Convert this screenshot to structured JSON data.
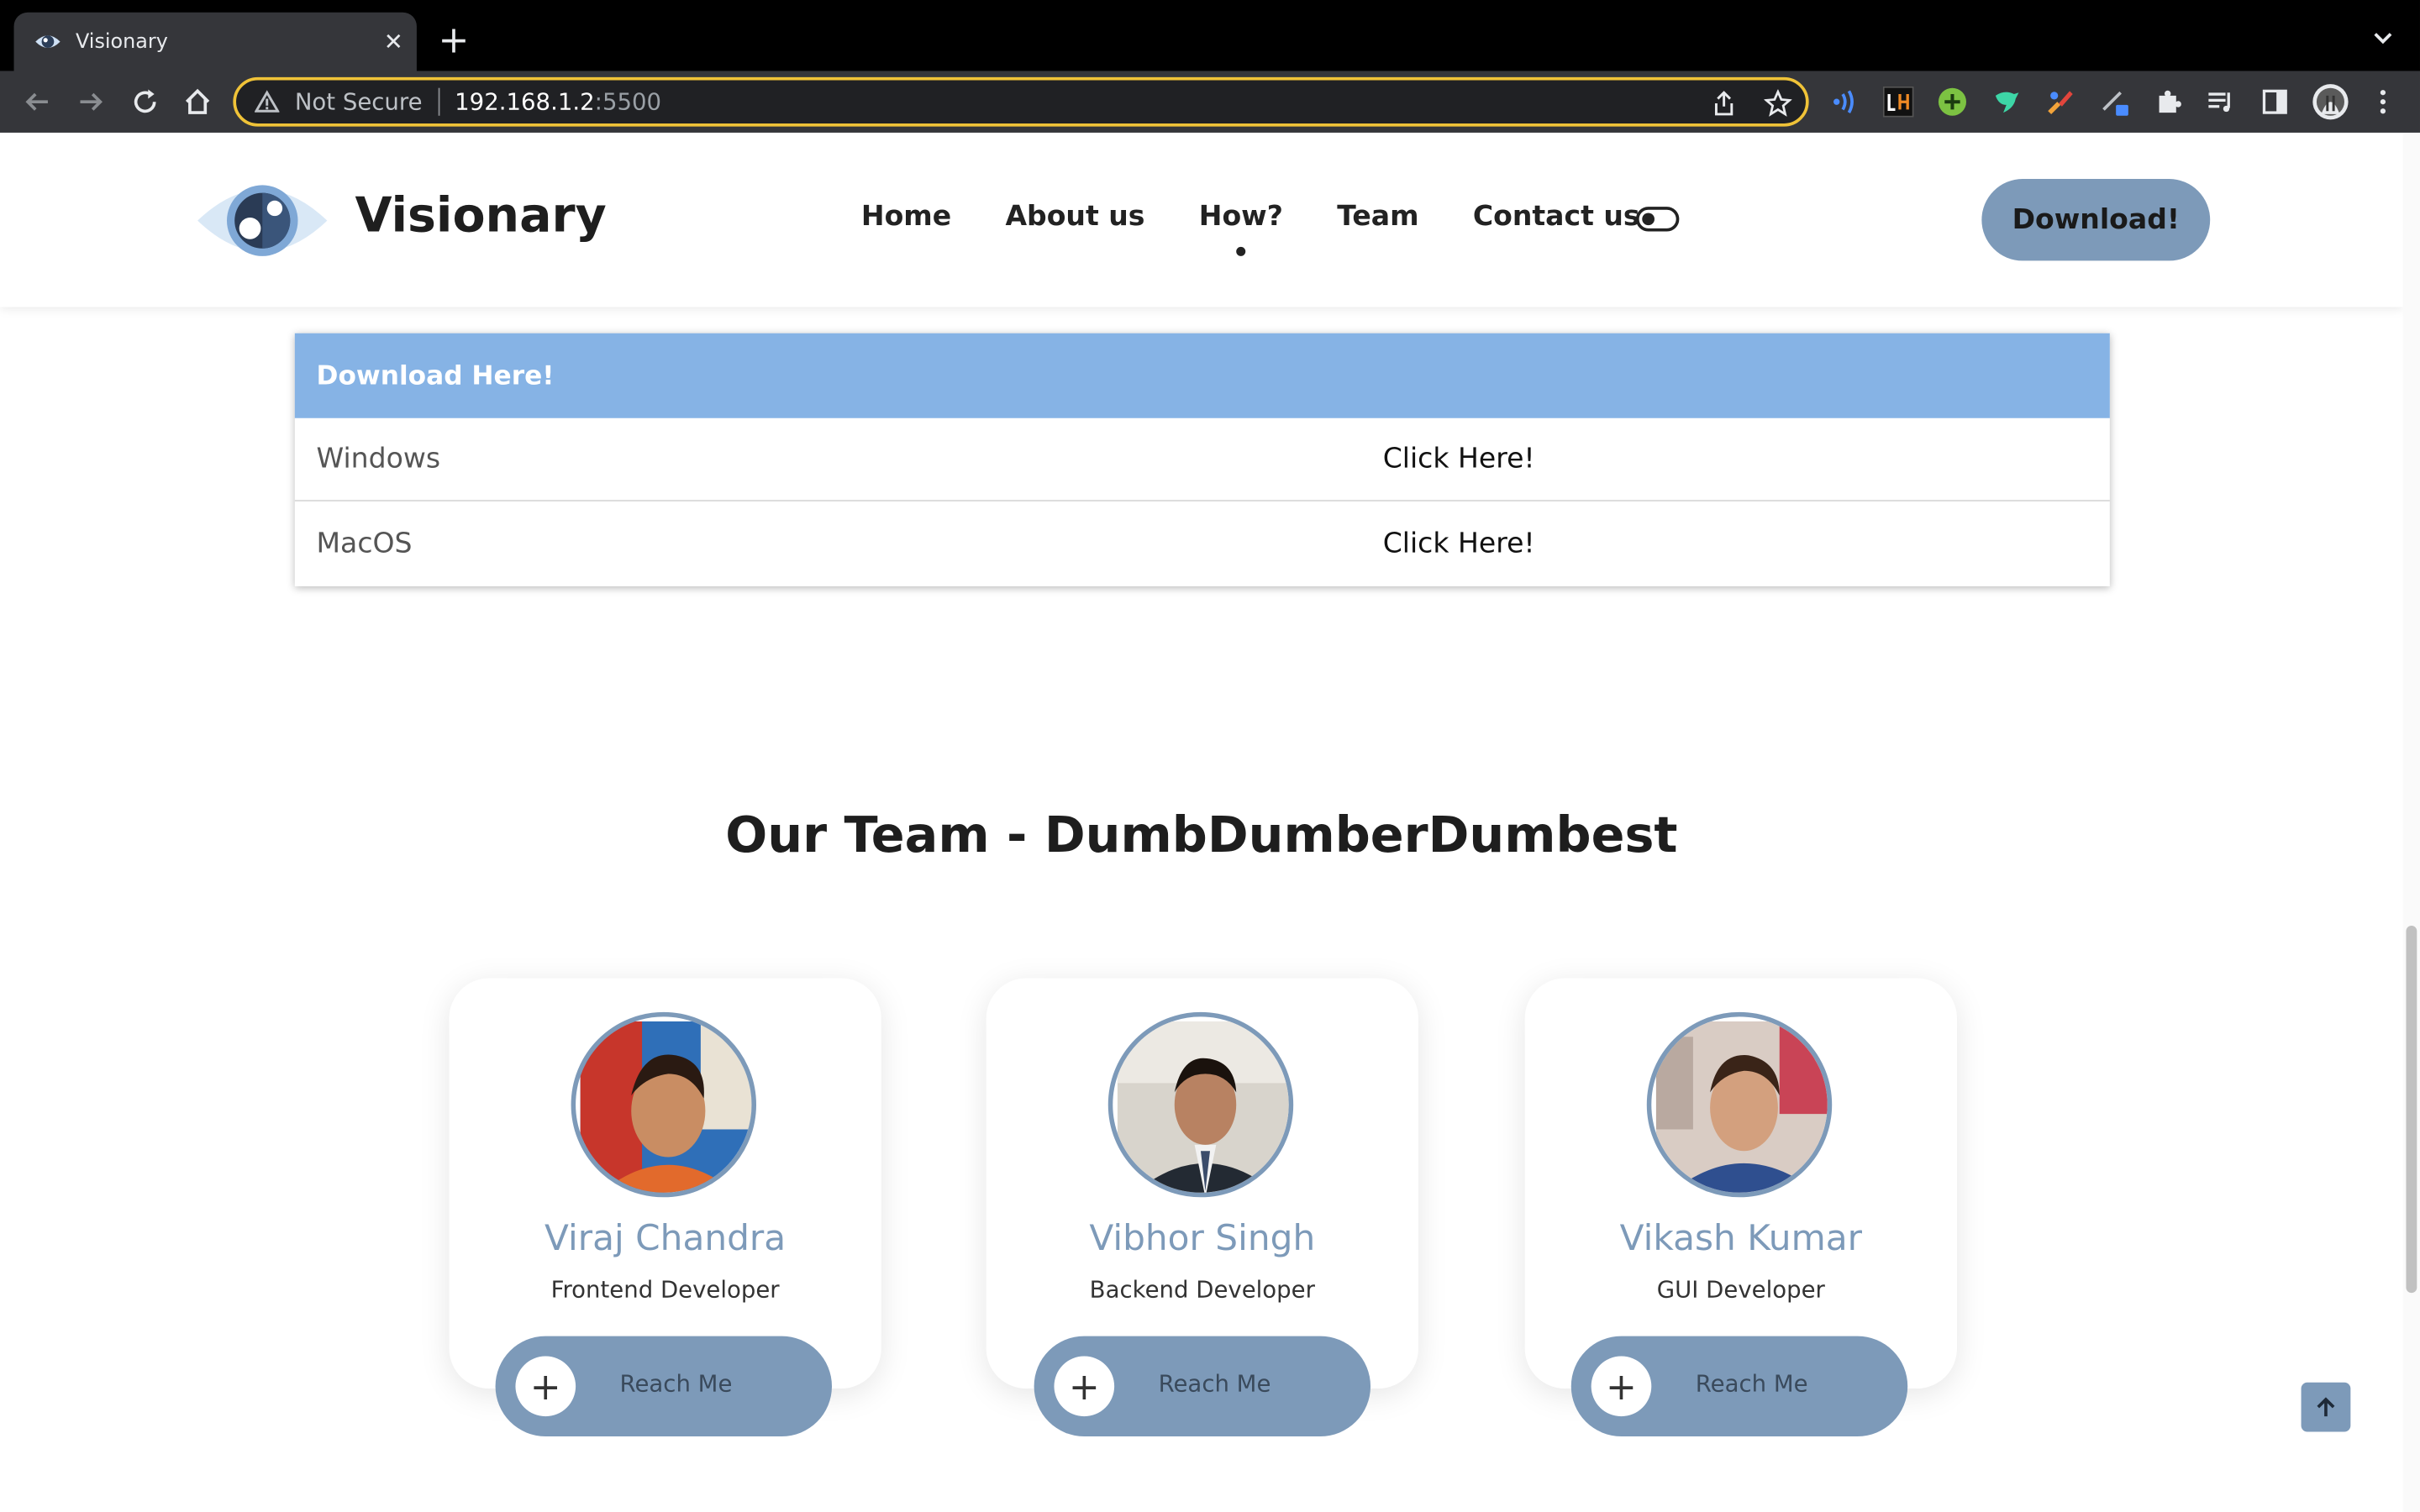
{
  "browser": {
    "tab_title": "Visionary",
    "new_tab": "+",
    "tab_close": "✕",
    "not_secure": "Not Secure",
    "url_host": "192.168.1.2",
    "url_port": ":5500"
  },
  "header": {
    "brand": "Visionary",
    "nav": [
      "Home",
      "About us",
      "How?",
      "Team",
      "Contact us"
    ],
    "active_nav": "How?",
    "download_button": "Download!"
  },
  "downloads": {
    "heading": "Download Here!",
    "rows": [
      {
        "os": "Windows",
        "link": "Click Here!"
      },
      {
        "os": "MacOS",
        "link": "Click Here!"
      }
    ]
  },
  "team": {
    "title": "Our Team - DumbDumberDumbest",
    "members": [
      {
        "name": "Viraj Chandra",
        "role": "Frontend Developer",
        "button": "Reach Me"
      },
      {
        "name": "Vibhor Singh",
        "role": "Backend Developer",
        "button": "Reach Me"
      },
      {
        "name": "Vikash Kumar",
        "role": "GUI Developer",
        "button": "Reach Me"
      }
    ]
  },
  "colors": {
    "accent": "#7d9ab9",
    "table_header": "#86b3e5",
    "omnibox_border": "#f0c338"
  },
  "icons": {
    "tab": "eye-favicon",
    "toolbar": [
      "back-arrow",
      "forward-arrow",
      "reload",
      "home"
    ],
    "omnibox": [
      "share",
      "bookmark-star"
    ],
    "extensions": [
      "wifi-extension",
      "lighthouse-extension",
      "plus-extension",
      "bird-extension",
      "paint-extension",
      "pen-extension",
      "puzzle-extension",
      "media-queue",
      "side-panel",
      "profile-avatar",
      "kebab-menu"
    ]
  }
}
